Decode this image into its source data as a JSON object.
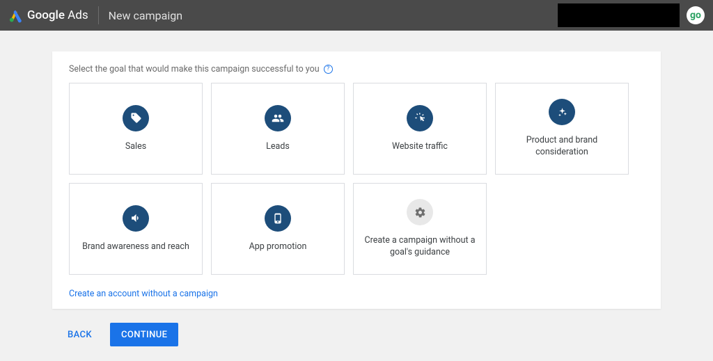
{
  "header": {
    "brand_google": "Google",
    "brand_ads": "Ads",
    "breadcrumb": "New campaign",
    "avatar_label": "go"
  },
  "panel": {
    "prompt": "Select the goal that would make this campaign successful to you",
    "goals": [
      {
        "label": "Sales"
      },
      {
        "label": "Leads"
      },
      {
        "label": "Website traffic"
      },
      {
        "label": "Product and brand consideration"
      },
      {
        "label": "Brand awareness and reach"
      },
      {
        "label": "App promotion"
      },
      {
        "label": "Create a campaign without a goal's guidance"
      }
    ],
    "alt_link": "Create an account without a campaign"
  },
  "footer": {
    "back": "Back",
    "continue": "Continue"
  }
}
